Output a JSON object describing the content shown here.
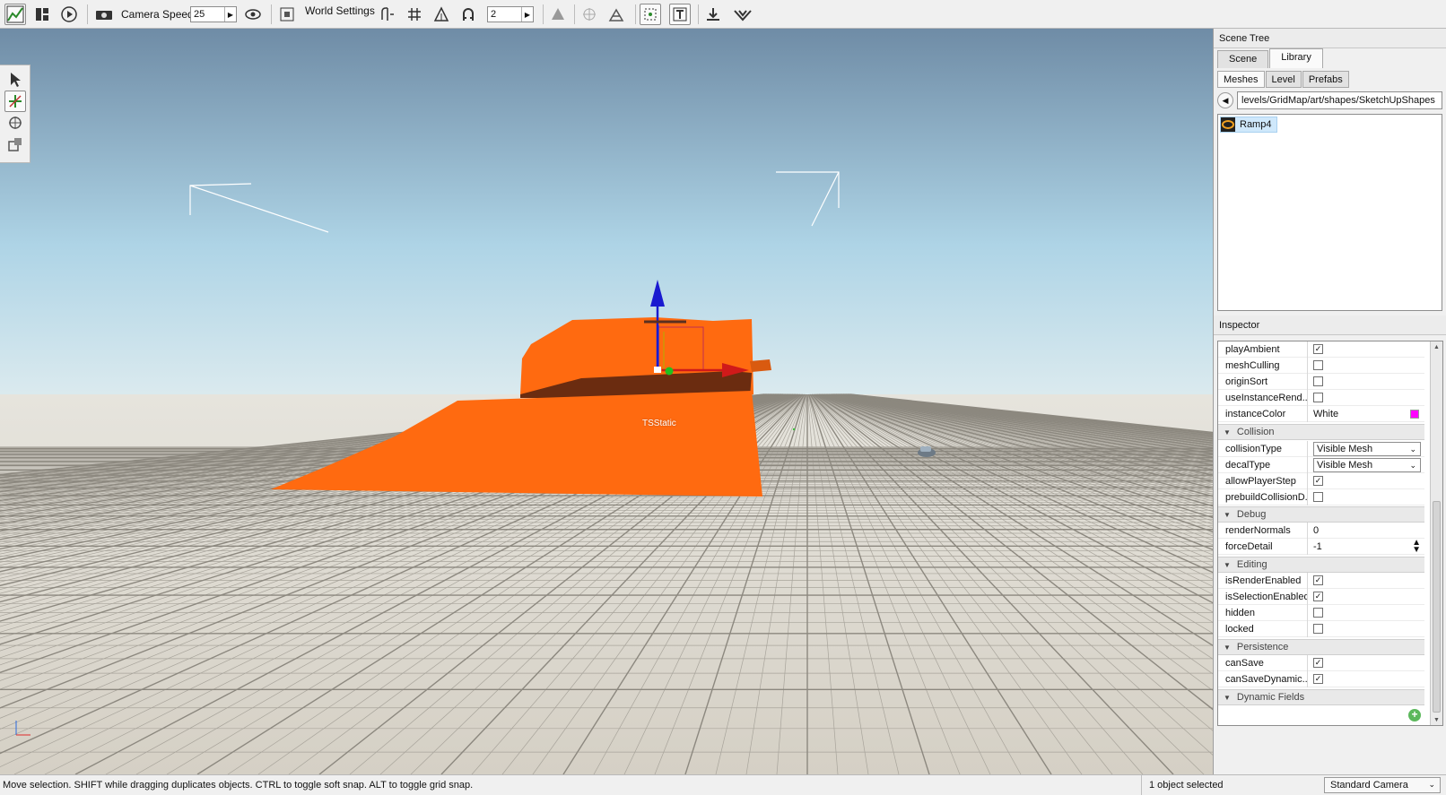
{
  "toolbar": {
    "camera_speed_label": "Camera Speed",
    "camera_speed_value": "25",
    "world_settings_label": "World Settings",
    "grid_snap_value": "2"
  },
  "viewport": {
    "object_label": "TSStatic",
    "colors": {
      "sky_top": "#6f8ca6",
      "sky_bottom": "#d5eef6",
      "ground": "#dedad1",
      "mesh": "#ff6a10",
      "mesh_shadow": "#6b2c10"
    }
  },
  "scene_tree": {
    "title": "Scene Tree",
    "tabs": [
      "Scene",
      "Library"
    ],
    "active_tab": "Library",
    "subtabs": [
      "Meshes",
      "Level",
      "Prefabs"
    ],
    "active_subtab": "Meshes",
    "path": "levels/GridMap/art/shapes/SketchUpShapes",
    "items": [
      {
        "label": "Ramp4",
        "icon": "mesh-icon"
      }
    ]
  },
  "inspector": {
    "title": "Inspector",
    "rows_top": [
      {
        "label": "playAmbient",
        "checked": true
      },
      {
        "label": "meshCulling",
        "checked": false
      },
      {
        "label": "originSort",
        "checked": false
      },
      {
        "label": "useInstanceRend...",
        "checked": false
      }
    ],
    "instance_color": {
      "label": "instanceColor",
      "value": "White",
      "swatch": "#ff00ff"
    },
    "groups": {
      "collision": "Collision",
      "debug": "Debug",
      "editing": "Editing",
      "persistence": "Persistence",
      "dynamic": "Dynamic Fields"
    },
    "collision_type": {
      "label": "collisionType",
      "value": "Visible Mesh"
    },
    "decal_type": {
      "label": "decalType",
      "value": "Visible Mesh"
    },
    "allow_player_step": {
      "label": "allowPlayerStep",
      "checked": true
    },
    "prebuild_collision": {
      "label": "prebuildCollisionD...",
      "checked": false
    },
    "render_normals": {
      "label": "renderNormals",
      "value": "0"
    },
    "force_detail": {
      "label": "forceDetail",
      "value": "-1"
    },
    "editing_rows": [
      {
        "label": "isRenderEnabled",
        "checked": true
      },
      {
        "label": "isSelectionEnabled",
        "checked": true
      },
      {
        "label": "hidden",
        "checked": false
      },
      {
        "label": "locked",
        "checked": false
      }
    ],
    "persistence_rows": [
      {
        "label": "canSave",
        "checked": true
      },
      {
        "label": "canSaveDynamic...",
        "checked": true
      }
    ]
  },
  "status_bar": {
    "message": "Move selection.  SHIFT while dragging duplicates objects.  CTRL to toggle soft snap.  ALT to toggle grid snap.",
    "selection": "1 object selected",
    "camera_mode": "Standard Camera"
  }
}
